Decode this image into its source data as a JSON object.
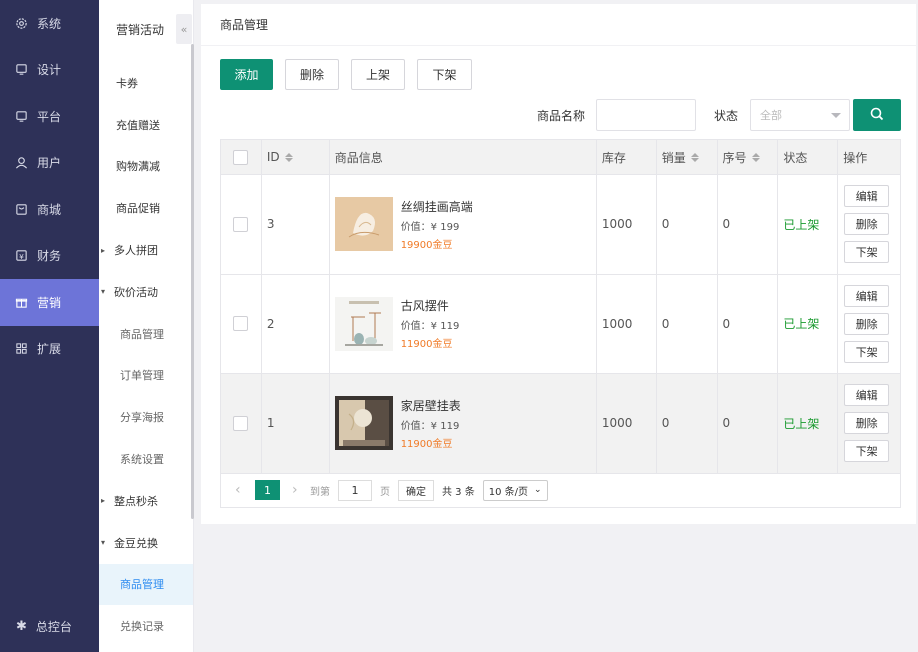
{
  "nav1": {
    "items": [
      {
        "label": "系统",
        "icon": "gear-icon"
      },
      {
        "label": "设计",
        "icon": "monitor-icon"
      },
      {
        "label": "平台",
        "icon": "monitor-icon"
      },
      {
        "label": "用户",
        "icon": "user-icon"
      },
      {
        "label": "商城",
        "icon": "shop-icon"
      },
      {
        "label": "财务",
        "icon": "finance-icon"
      },
      {
        "label": "营销",
        "icon": "gift-icon",
        "active": true
      },
      {
        "label": "扩展",
        "icon": "grid-icon"
      }
    ],
    "bottom": "总控台"
  },
  "nav2": {
    "head": "营销活动",
    "collapse": "«",
    "items": [
      {
        "label": "卡券"
      },
      {
        "label": "充值赠送"
      },
      {
        "label": "购物满减"
      },
      {
        "label": "商品促销"
      },
      {
        "label": "多人拼团",
        "caret": "▸"
      },
      {
        "label": "砍价活动",
        "caret": "▾"
      },
      {
        "label": "商品管理"
      },
      {
        "label": "订单管理"
      },
      {
        "label": "分享海报"
      },
      {
        "label": "系统设置"
      },
      {
        "label": "整点秒杀",
        "caret": "▸"
      },
      {
        "label": "金豆兑换",
        "caret": "▾"
      },
      {
        "label": "商品管理"
      },
      {
        "label": "兑换记录"
      }
    ]
  },
  "main": {
    "title": "商品管理",
    "toolbar": {
      "add": "添加",
      "delete": "删除",
      "on_shelf": "上架",
      "off_shelf": "下架"
    },
    "filter": {
      "name_label": "商品名称",
      "status_label": "状态",
      "status_value": "全部"
    },
    "table": {
      "headers": {
        "id": "ID",
        "info": "商品信息",
        "stock": "库存",
        "sales": "销量",
        "order": "序号",
        "status": "状态",
        "ops": "操作"
      },
      "rows": [
        {
          "id": "3",
          "name": "丝绸挂画高端",
          "price": "价值：¥ 199",
          "beans": "19900金豆",
          "stock": "1000",
          "sales": "0",
          "order": "0",
          "status": "已上架"
        },
        {
          "id": "2",
          "name": "古风摆件",
          "price": "价值：¥ 119",
          "beans": "11900金豆",
          "stock": "1000",
          "sales": "0",
          "order": "0",
          "status": "已上架"
        },
        {
          "id": "1",
          "name": "家居壁挂表",
          "price": "价值：¥ 119",
          "beans": "11900金豆",
          "stock": "1000",
          "sales": "0",
          "order": "0",
          "status": "已上架"
        }
      ],
      "ops": {
        "edit": "编辑",
        "delete": "删除",
        "off": "下架"
      }
    },
    "pager": {
      "current": "1",
      "goto": "到第",
      "page_input": "1",
      "page_unit": "页",
      "confirm": "确定",
      "total": "共 3 条",
      "page_size": "10 条/页"
    }
  },
  "colors": {
    "sidebar": "#2e3158",
    "active": "#6d74d8",
    "primary": "#0e9174",
    "on_status": "#1a9a2f",
    "beans": "#f07a26"
  }
}
